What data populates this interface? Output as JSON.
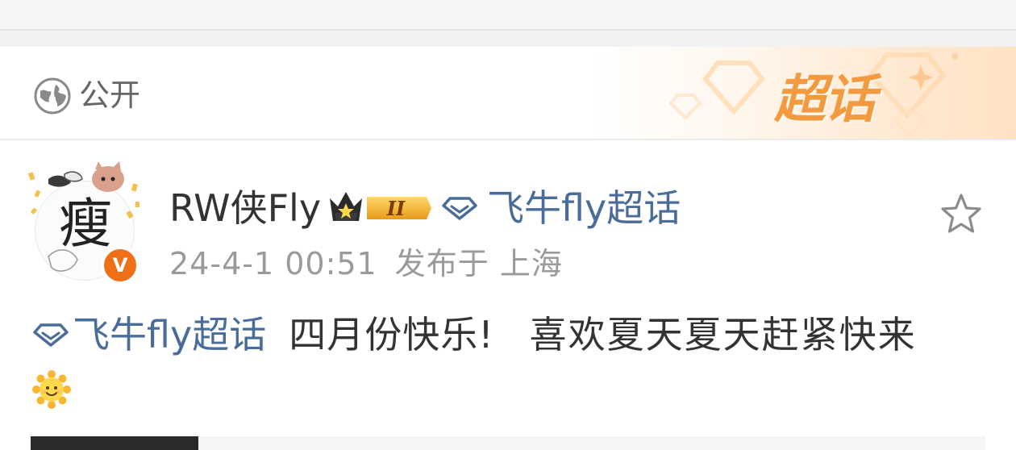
{
  "visibility": {
    "label": "公开",
    "icon": "globe-icon"
  },
  "supertopic_badge": "超话",
  "post": {
    "avatar_char": "瘦",
    "username": "RW侠Fly",
    "crown_badge": "II",
    "topic": "飞牛fly超话",
    "timestamp": "24-4-1 00:51",
    "location": "发布于 上海",
    "content_topic": "飞牛fly超话",
    "content_text_1": "四月份快乐!",
    "content_text_2": "喜欢夏天夏天赶紧快来",
    "emoji": "sun-smile-icon"
  },
  "colors": {
    "link": "#4a6c9a",
    "accent": "#f39a3e",
    "verified": "#ef6f16",
    "meta": "#9a9a9a"
  }
}
